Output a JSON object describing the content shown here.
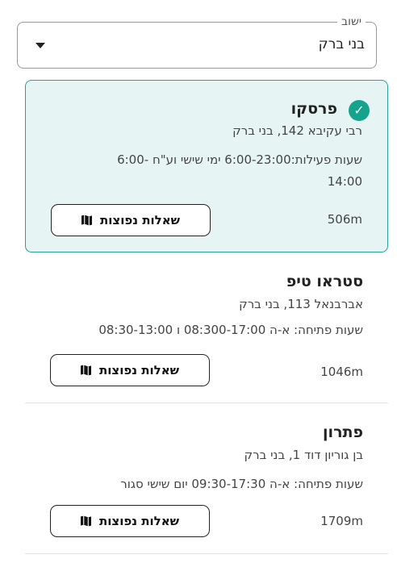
{
  "city_select": {
    "label": "ישוב",
    "value": "בני ברק",
    "caret_icon": "caret-down-icon"
  },
  "stores": [
    {
      "name": "פרסקו",
      "address": "רבי עקיבא 142, בני ברק",
      "hours_line1": "שעות פעילות:6:00-23:00 ימי שישי וע\"ח -6:00",
      "hours_line2": "14:00",
      "distance": "506m",
      "faq_label": "שאלות נפוצות",
      "selected": true
    },
    {
      "name": "סטראו טיפ",
      "address": "אברבנאל 113, בני ברק",
      "hours_line1": "שעות פתיחה: א-ה 08:300-17:00 ו 08:30-13:00",
      "distance": "1046m",
      "faq_label": "שאלות נפוצות",
      "selected": false
    },
    {
      "name": "פתרון",
      "address": "בן גוריון דוד 1, בני ברק",
      "hours_line1": "שעות פתיחה: א-ה 09:30-17:30 יום שישי סגור",
      "distance": "1709m",
      "faq_label": "שאלות נפוצות",
      "selected": false
    }
  ],
  "colors": {
    "selected_bg": "#e6f5f3",
    "selected_border": "#25a394",
    "check": "#16a38d"
  }
}
